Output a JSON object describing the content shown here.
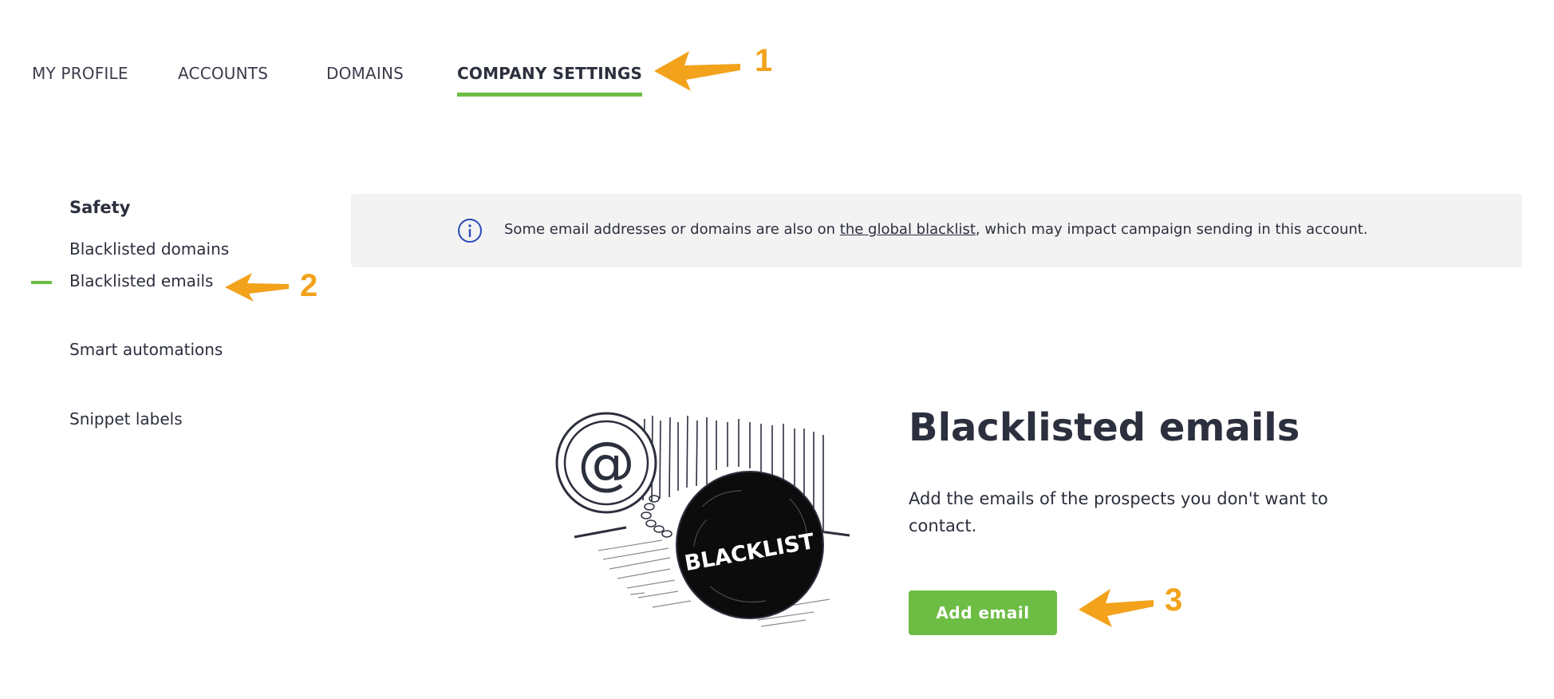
{
  "tabs": [
    {
      "label": "MY PROFILE",
      "active": false
    },
    {
      "label": "ACCOUNTS",
      "active": false
    },
    {
      "label": "DOMAINS",
      "active": false
    },
    {
      "label": "COMPANY SETTINGS",
      "active": true
    }
  ],
  "sidebar": {
    "heading": "Safety",
    "items": [
      {
        "label": "Blacklisted domains",
        "active": false
      },
      {
        "label": "Blacklisted emails",
        "active": true
      },
      {
        "label": "Smart automations",
        "active": false
      },
      {
        "label": "Snippet labels",
        "active": false
      }
    ]
  },
  "banner": {
    "text_before": "Some email addresses or domains are also on ",
    "link": "the global blacklist",
    "text_after": ", which may impact campaign sending in this account."
  },
  "illustration": {
    "at_symbol": "@",
    "ball_label": "BLACKLIST"
  },
  "empty_state": {
    "title": "Blacklisted emails",
    "description": "Add the emails of the prospects you don't want to contact.",
    "button_label": "Add email"
  },
  "annotations": {
    "one": "1",
    "two": "2",
    "three": "3"
  },
  "colors": {
    "accent": "#6dbd45",
    "annotation": "#f2a21b",
    "info_icon": "#2a49b8"
  }
}
